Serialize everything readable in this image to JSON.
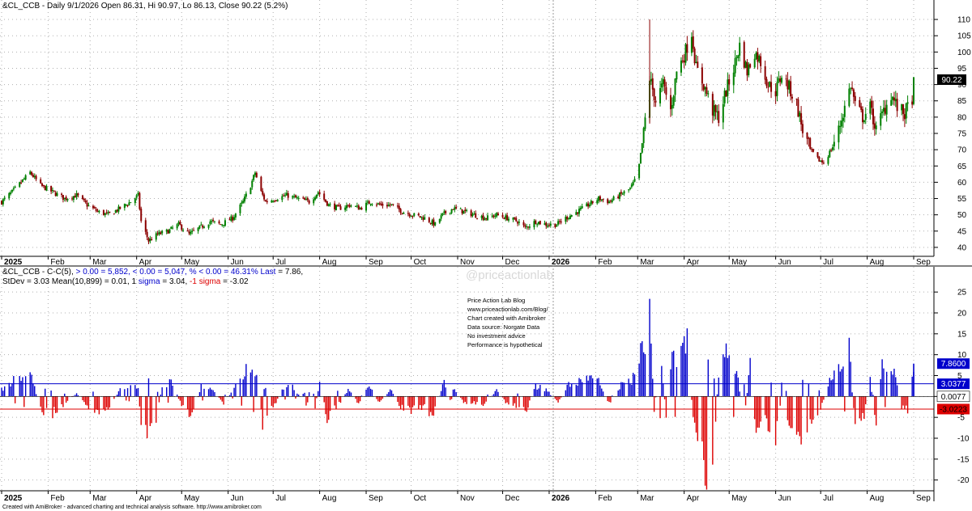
{
  "colors": {
    "up_candle": "#008000",
    "down_candle": "#8b0000",
    "pos_bar": "#0000cc",
    "neg_bar": "#dd0000",
    "grid": "#b0b0b0",
    "axis_text": "#000000",
    "blue_text": "#0000cc",
    "red_text": "#dd0000"
  },
  "price_panel": {
    "header": "&CL_CCB - Daily 9/1/2026 Open 86.31, Hi 90.97, Lo 86.13, Close 90.22 (5.2%)",
    "last_price_label": "90.22",
    "y_ticks": [
      "40",
      "45",
      "50",
      "55",
      "60",
      "65",
      "70",
      "75",
      "80",
      "85",
      "90",
      "95",
      "100",
      "105",
      "110"
    ]
  },
  "osc_panel": {
    "header_prefix": "&CL_CCB - C-C(5),",
    "header_pos": "  > 0.00 = 5,852,  < 0.00 = 5,047,  % < 0.00 = 46.31% Last",
    "header_last": " = 7.86,",
    "stats_prefix": "StDev = 3.03 Mean(10,899)  = 0.01, 1 ",
    "stats_plus_sigma": " sigma",
    "stats_mid": "  = 3.04, ",
    "stats_minus": "-1",
    "stats_minus_sigma": " sigma",
    "stats_end": "  = -3.02",
    "y_ticks": [
      "-20",
      "-15",
      "-10",
      "-5",
      "0",
      "5",
      "10",
      "15",
      "20",
      "25"
    ],
    "last_label": "7.8600",
    "plus_sigma_label": "3.0377",
    "mean_label": "0.0077",
    "minus_sigma_label": "-3.0223",
    "info_lines": [
      "Price Action Lab Blog",
      "www.priceactionlab.com/Blog/",
      "Chart created with Amibroker",
      "Data source: Norgate Data",
      "No investment advice",
      "Performance is hypothetical"
    ]
  },
  "x_axis_labels": [
    "2025",
    "Feb",
    "Mar",
    "Apr",
    "May",
    "Jun",
    "Jul",
    "Aug",
    "Sep",
    "Oct",
    "Nov",
    "Dec",
    "2026",
    "Feb",
    "Mar",
    "Apr",
    "May",
    "Jun",
    "Jul",
    "Aug",
    "Sep"
  ],
  "watermark": "@priceactionlab",
  "footer": "Created with AmiBroker - advanced charting and technical analysis software. http://www.amibroker.com",
  "chart_data": [
    {
      "type": "candlestick",
      "title": "&CL_CCB - Daily 9/1/2026 Open 86.31, Hi 90.97, Lo 86.13, Close 90.22 (5.2%)",
      "x_range": [
        "2025-01-01",
        "2026-09-01"
      ],
      "ylim": [
        38,
        112
      ],
      "ohlc_last": {
        "open": 86.31,
        "high": 90.97,
        "low": 86.13,
        "close": 90.22
      },
      "close_path": [
        [
          "2025-01-01",
          54
        ],
        [
          "2025-01-08",
          57
        ],
        [
          "2025-01-14",
          60
        ],
        [
          "2025-01-20",
          63
        ],
        [
          "2025-01-27",
          59
        ],
        [
          "2025-02-04",
          57
        ],
        [
          "2025-02-12",
          55
        ],
        [
          "2025-02-20",
          56
        ],
        [
          "2025-02-27",
          53
        ],
        [
          "2025-03-06",
          51
        ],
        [
          "2025-03-13",
          50
        ],
        [
          "2025-03-21",
          52
        ],
        [
          "2025-03-28",
          54
        ],
        [
          "2025-04-02",
          56
        ],
        [
          "2025-04-04",
          48
        ],
        [
          "2025-04-09",
          42
        ],
        [
          "2025-04-15",
          44
        ],
        [
          "2025-04-22",
          45
        ],
        [
          "2025-04-29",
          47
        ],
        [
          "2025-05-06",
          44
        ],
        [
          "2025-05-13",
          46
        ],
        [
          "2025-05-20",
          48
        ],
        [
          "2025-05-27",
          47
        ],
        [
          "2025-06-04",
          49
        ],
        [
          "2025-06-11",
          54
        ],
        [
          "2025-06-16",
          59
        ],
        [
          "2025-06-19",
          63
        ],
        [
          "2025-06-23",
          57
        ],
        [
          "2025-06-26",
          54
        ],
        [
          "2025-07-03",
          55
        ],
        [
          "2025-07-10",
          56
        ],
        [
          "2025-07-17",
          55
        ],
        [
          "2025-07-25",
          54
        ],
        [
          "2025-07-31",
          57
        ],
        [
          "2025-08-07",
          53
        ],
        [
          "2025-08-14",
          52
        ],
        [
          "2025-08-21",
          53
        ],
        [
          "2025-08-28",
          52
        ],
        [
          "2025-09-04",
          54
        ],
        [
          "2025-09-11",
          53
        ],
        [
          "2025-09-18",
          53
        ],
        [
          "2025-09-25",
          51
        ],
        [
          "2025-10-02",
          50
        ],
        [
          "2025-10-10",
          49
        ],
        [
          "2025-10-17",
          47
        ],
        [
          "2025-10-22",
          50
        ],
        [
          "2025-10-29",
          52
        ],
        [
          "2025-11-05",
          51
        ],
        [
          "2025-11-12",
          50
        ],
        [
          "2025-11-20",
          49
        ],
        [
          "2025-11-27",
          50
        ],
        [
          "2025-12-04",
          49
        ],
        [
          "2025-12-11",
          48
        ],
        [
          "2025-12-16",
          46
        ],
        [
          "2025-12-23",
          48
        ],
        [
          "2025-12-30",
          47
        ],
        [
          "2026-01-06",
          47
        ],
        [
          "2026-01-12",
          49
        ],
        [
          "2026-01-20",
          51
        ],
        [
          "2026-01-27",
          53
        ],
        [
          "2026-02-03",
          55
        ],
        [
          "2026-02-10",
          54
        ],
        [
          "2026-02-17",
          56
        ],
        [
          "2026-02-24",
          58
        ],
        [
          "2026-03-01",
          62
        ],
        [
          "2026-03-05",
          75
        ],
        [
          "2026-03-09",
          92
        ],
        [
          "2026-03-13",
          85
        ],
        [
          "2026-03-18",
          90
        ],
        [
          "2026-03-23",
          82
        ],
        [
          "2026-03-27",
          94
        ],
        [
          "2026-04-01",
          99
        ],
        [
          "2026-04-06",
          106
        ],
        [
          "2026-04-09",
          95
        ],
        [
          "2026-04-14",
          90
        ],
        [
          "2026-04-20",
          82
        ],
        [
          "2026-04-24",
          80
        ],
        [
          "2026-04-29",
          88
        ],
        [
          "2026-05-04",
          95
        ],
        [
          "2026-05-08",
          102
        ],
        [
          "2026-05-13",
          94
        ],
        [
          "2026-05-18",
          100
        ],
        [
          "2026-05-22",
          97
        ],
        [
          "2026-05-27",
          90
        ],
        [
          "2026-06-01",
          88
        ],
        [
          "2026-06-05",
          93
        ],
        [
          "2026-06-10",
          89
        ],
        [
          "2026-06-15",
          84
        ],
        [
          "2026-06-19",
          76
        ],
        [
          "2026-06-24",
          70
        ],
        [
          "2026-06-29",
          67
        ],
        [
          "2026-07-03",
          66
        ],
        [
          "2026-07-08",
          70
        ],
        [
          "2026-07-13",
          76
        ],
        [
          "2026-07-17",
          83
        ],
        [
          "2026-07-21",
          90
        ],
        [
          "2026-07-24",
          84
        ],
        [
          "2026-07-29",
          80
        ],
        [
          "2026-08-03",
          83
        ],
        [
          "2026-08-07",
          76
        ],
        [
          "2026-08-12",
          82
        ],
        [
          "2026-08-17",
          87
        ],
        [
          "2026-08-21",
          83
        ],
        [
          "2026-08-26",
          81
        ],
        [
          "2026-08-31",
          86
        ],
        [
          "2026-09-01",
          90.22
        ]
      ],
      "last_value_label": 90.22
    },
    {
      "type": "bar",
      "title": "&CL_CCB - C-C(5)",
      "x_range": [
        "2025-01-01",
        "2026-09-01"
      ],
      "ylim": [
        -22,
        26
      ],
      "reference_lines": {
        "plus_1_sigma": 3.0377,
        "mean": 0.0077,
        "minus_1_sigma": -3.0223
      },
      "stats": {
        "count_positive": 5852,
        "count_negative": 5047,
        "pct_negative": 46.31,
        "last": 7.86,
        "stdev": 3.03,
        "mean": 0.01,
        "sigma_plus": 3.04,
        "sigma_minus": -3.02
      },
      "value_path": [
        [
          "2025-01-01",
          2
        ],
        [
          "2025-01-08",
          4
        ],
        [
          "2025-01-14",
          6
        ],
        [
          "2025-01-20",
          7
        ],
        [
          "2025-01-27",
          -4
        ],
        [
          "2025-02-04",
          -5
        ],
        [
          "2025-02-12",
          -2
        ],
        [
          "2025-02-20",
          1
        ],
        [
          "2025-02-27",
          -3
        ],
        [
          "2025-03-06",
          -4
        ],
        [
          "2025-03-13",
          -3
        ],
        [
          "2025-03-21",
          2
        ],
        [
          "2025-03-28",
          3
        ],
        [
          "2025-04-02",
          2
        ],
        [
          "2025-04-04",
          -7
        ],
        [
          "2025-04-09",
          -11
        ],
        [
          "2025-04-13",
          -9
        ],
        [
          "2025-04-18",
          3
        ],
        [
          "2025-04-25",
          4
        ],
        [
          "2025-05-01",
          -3
        ],
        [
          "2025-05-08",
          -5
        ],
        [
          "2025-05-14",
          3
        ],
        [
          "2025-05-22",
          2
        ],
        [
          "2025-05-29",
          -2
        ],
        [
          "2025-06-05",
          2
        ],
        [
          "2025-06-11",
          6
        ],
        [
          "2025-06-17",
          10
        ],
        [
          "2025-06-20",
          8
        ],
        [
          "2025-06-24",
          -7
        ],
        [
          "2025-06-30",
          -4
        ],
        [
          "2025-07-07",
          2
        ],
        [
          "2025-07-14",
          3
        ],
        [
          "2025-07-22",
          -2
        ],
        [
          "2025-07-29",
          -3
        ],
        [
          "2025-08-01",
          4
        ],
        [
          "2025-08-06",
          -6
        ],
        [
          "2025-08-13",
          -3
        ],
        [
          "2025-08-20",
          2
        ],
        [
          "2025-08-27",
          -2
        ],
        [
          "2025-09-03",
          3
        ],
        [
          "2025-09-10",
          -2
        ],
        [
          "2025-09-17",
          2
        ],
        [
          "2025-09-24",
          -3
        ],
        [
          "2025-10-01",
          -4
        ],
        [
          "2025-10-09",
          -3
        ],
        [
          "2025-10-16",
          -5
        ],
        [
          "2025-10-23",
          4
        ],
        [
          "2025-10-30",
          2
        ],
        [
          "2025-11-06",
          -2
        ],
        [
          "2025-11-13",
          -2
        ],
        [
          "2025-11-20",
          -2
        ],
        [
          "2025-11-27",
          2
        ],
        [
          "2025-12-04",
          -2
        ],
        [
          "2025-12-11",
          -3
        ],
        [
          "2025-12-17",
          -4
        ],
        [
          "2025-12-23",
          3
        ],
        [
          "2025-12-30",
          2
        ],
        [
          "2026-01-07",
          -2
        ],
        [
          "2026-01-13",
          3
        ],
        [
          "2026-01-20",
          4
        ],
        [
          "2026-01-27",
          5
        ],
        [
          "2026-02-03",
          4
        ],
        [
          "2026-02-10",
          -2
        ],
        [
          "2026-02-17",
          3
        ],
        [
          "2026-02-24",
          4
        ],
        [
          "2026-03-02",
          9
        ],
        [
          "2026-03-05",
          16
        ],
        [
          "2026-03-09",
          23
        ],
        [
          "2026-03-12",
          -5
        ],
        [
          "2026-03-16",
          14
        ],
        [
          "2026-03-20",
          -6
        ],
        [
          "2026-03-24",
          10
        ],
        [
          "2026-03-30",
          12
        ],
        [
          "2026-04-03",
          15
        ],
        [
          "2026-04-07",
          -7
        ],
        [
          "2026-04-10",
          -10
        ],
        [
          "2026-04-14",
          -19
        ],
        [
          "2026-04-17",
          -21
        ],
        [
          "2026-04-21",
          -12
        ],
        [
          "2026-04-24",
          7
        ],
        [
          "2026-04-28",
          12
        ],
        [
          "2026-05-02",
          14
        ],
        [
          "2026-05-06",
          8
        ],
        [
          "2026-05-11",
          -8
        ],
        [
          "2026-05-15",
          11
        ],
        [
          "2026-05-19",
          -10
        ],
        [
          "2026-05-22",
          -6
        ],
        [
          "2026-05-27",
          -9
        ],
        [
          "2026-06-01",
          -14
        ],
        [
          "2026-06-04",
          7
        ],
        [
          "2026-06-08",
          -6
        ],
        [
          "2026-06-12",
          -8
        ],
        [
          "2026-06-16",
          -11
        ],
        [
          "2026-06-19",
          -13
        ],
        [
          "2026-06-23",
          -10
        ],
        [
          "2026-06-27",
          -7
        ],
        [
          "2026-07-01",
          -4
        ],
        [
          "2026-07-06",
          4
        ],
        [
          "2026-07-10",
          8
        ],
        [
          "2026-07-15",
          11
        ],
        [
          "2026-07-20",
          14
        ],
        [
          "2026-07-23",
          -5
        ],
        [
          "2026-07-27",
          -8
        ],
        [
          "2026-07-30",
          -6
        ],
        [
          "2026-08-03",
          5
        ],
        [
          "2026-08-07",
          -8
        ],
        [
          "2026-08-11",
          8
        ],
        [
          "2026-08-15",
          5
        ],
        [
          "2026-08-19",
          7
        ],
        [
          "2026-08-24",
          -3
        ],
        [
          "2026-08-28",
          -4
        ],
        [
          "2026-09-01",
          7.86
        ]
      ],
      "last_value_label": 7.86
    }
  ]
}
